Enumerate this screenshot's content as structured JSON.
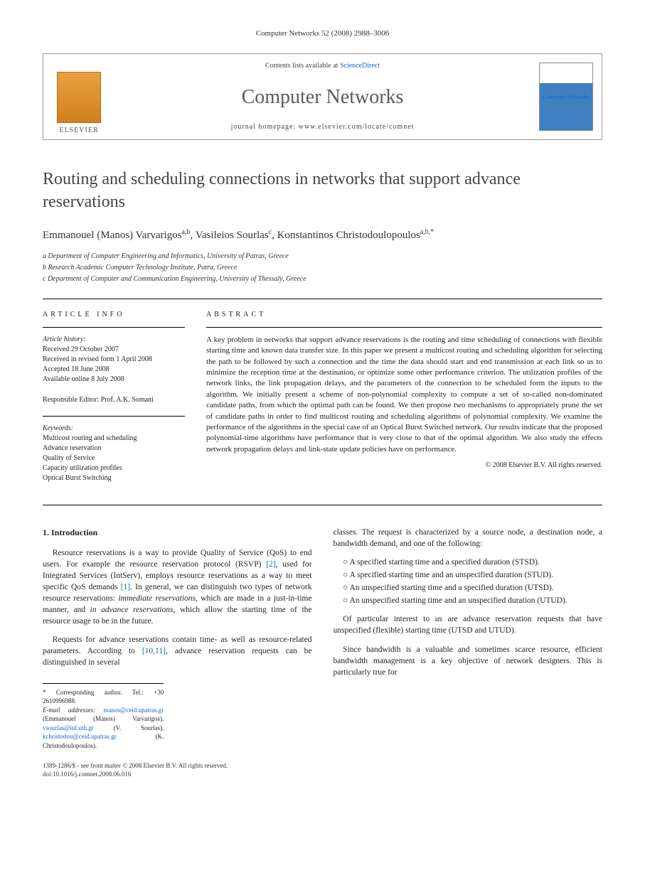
{
  "journal_header": "Computer Networks 52 (2008) 2988–3006",
  "banner": {
    "contents_prefix": "Contents lists available at ",
    "contents_link": "ScienceDirect",
    "journal_name": "Computer Networks",
    "homepage_prefix": "journal homepage: ",
    "homepage_url": "www.elsevier.com/locate/comnet",
    "publisher": "ELSEVIER",
    "cover_text": "Computer Networks"
  },
  "title": "Routing and scheduling connections in networks that support advance reservations",
  "authors_line": "Emmanouel (Manos) Varvarigos a,b, Vasileios Sourlas c, Konstantinos Christodoulopoulos a,b,*",
  "affiliations": [
    "a Department of Computer Engineering and Informatics, University of Patras, Greece",
    "b Research Academic Computer Technology Institute, Patra, Greece",
    "c Department of Computer and Communication Engineering, University of Thessaly, Greece"
  ],
  "article_info": {
    "label": "ARTICLE INFO",
    "history_label": "Article history:",
    "history": [
      "Received 29 October 2007",
      "Received in revised form 1 April 2008",
      "Accepted 18 June 2008",
      "Available online 8 July 2008"
    ],
    "editor_label": "Responsible Editor: Prof. A.K. Somani",
    "keywords_label": "Keywords:",
    "keywords": [
      "Multicost routing and scheduling",
      "Advance reservation",
      "Quality of Service",
      "Capacity utilization profiles",
      "Optical Burst Switching"
    ]
  },
  "abstract": {
    "label": "ABSTRACT",
    "text": "A key problem in networks that support advance reservations is the routing and time scheduling of connections with flexible starting time and known data transfer size. In this paper we present a multicost routing and scheduling algorithm for selecting the path to be followed by such a connection and the time the data should start and end transmission at each link so as to minimize the reception time at the destination, or optimize some other performance criterion. The utilization profiles of the network links, the link propagation delays, and the parameters of the connection to be scheduled form the inputs to the algorithm. We initially present a scheme of non-polynomial complexity to compute a set of so-called non-dominated candidate paths, from which the optimal path can be found. We then propose two mechanisms to appropriately prune the set of candidate paths in order to find multicost routing and scheduling algorithms of polynomial complexity. We examine the performance of the algorithms in the special case of an Optical Burst Switched network. Our results indicate that the proposed polynomial-time algorithms have performance that is very close to that of the optimal algorithm. We also study the effects network propagation delays and link-state update policies have on performance.",
    "copyright": "© 2008 Elsevier B.V. All rights reserved."
  },
  "body": {
    "section_1_heading": "1. Introduction",
    "left_paragraphs": [
      "Resource reservations is a way to provide Quality of Service (QoS) to end users. For example the resource reservation protocol (RSVP) [2], used for Integrated Services (IntServ), employs resource reservations as a way to meet specific QoS demands [1]. In general, we can distinguish two types of network resource reservations: immediate reservations, which are made in a just-in-time manner, and in advance reservations, which allow the starting time of the resource usage to be in the future.",
      "Requests for advance reservations contain time- as well as resource-related parameters. According to [10,11], advance reservation requests can be distinguished in several"
    ],
    "right_intro": "classes. The request is characterized by a source node, a destination node, a bandwidth demand, and one of the following:",
    "bullets": [
      "A specified starting time and a specified duration (STSD).",
      "A specified starting time and an unspecified duration (STUD).",
      "An unspecified starting time and a specified duration (UTSD).",
      "An unspecified starting time and an unspecified duration (UTUD)."
    ],
    "right_paragraphs": [
      "Of particular interest to us are advance reservation requests that have unspecified (flexible) starting time (UTSD and UTUD).",
      "Since bandwidth is a valuable and sometimes scarce resource, efficient bandwidth management is a key objective of network designers. This is particularly true for"
    ]
  },
  "footnotes": {
    "corresponding": "* Corresponding author. Tel.: +30 2610996988.",
    "email_label": "E-mail addresses:",
    "emails": [
      {
        "addr": "manos@ceid.upatras.gr",
        "who": "(Emmanouel (Manos) Varvarigos),"
      },
      {
        "addr": "vsourlas@inf.uth.gr",
        "who": "(V. Sourlas),"
      },
      {
        "addr": "kchristodou@ceid.upatras.gr",
        "who": "(K. Christodoulopoulos)."
      }
    ]
  },
  "bottom_meta": {
    "line1": "1389-1286/$ - see front matter © 2008 Elsevier B.V. All rights reserved.",
    "line2": "doi:10.1016/j.comnet.2008.06.016"
  }
}
